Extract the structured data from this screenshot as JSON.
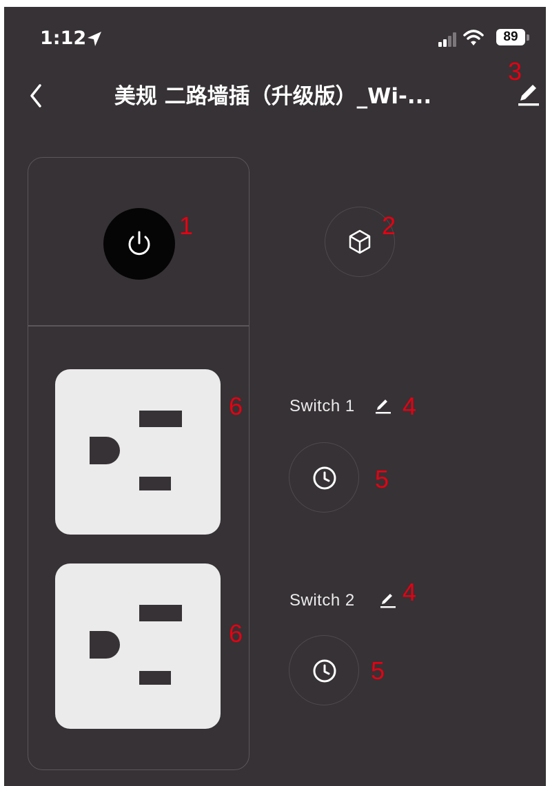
{
  "status_bar": {
    "time": "1:12",
    "battery": "89",
    "icons": [
      "location-arrow-icon",
      "signal-icon",
      "wifi-icon",
      "battery-icon"
    ]
  },
  "nav": {
    "title": "美规 二路墙插（升级版）_Wi-...",
    "back_icon": "chevron-left-icon",
    "edit_icon": "pencil-icon"
  },
  "controls": {
    "power_icon": "power-icon",
    "scene_icon": "cube-icon"
  },
  "switches": [
    {
      "label": "Switch 1",
      "edit_icon": "pencil-icon",
      "timer_icon": "clock-icon"
    },
    {
      "label": "Switch 2",
      "edit_icon": "pencil-icon",
      "timer_icon": "clock-icon"
    }
  ],
  "annotations": {
    "power": "1",
    "scene": "2",
    "edit_name": "3",
    "edit_switch": "4",
    "timer": "5",
    "outlet": "6"
  },
  "colors": {
    "background": "#363235",
    "annotation": "#e60012",
    "outlet": "#ebebeb",
    "power_button": "#050505"
  }
}
